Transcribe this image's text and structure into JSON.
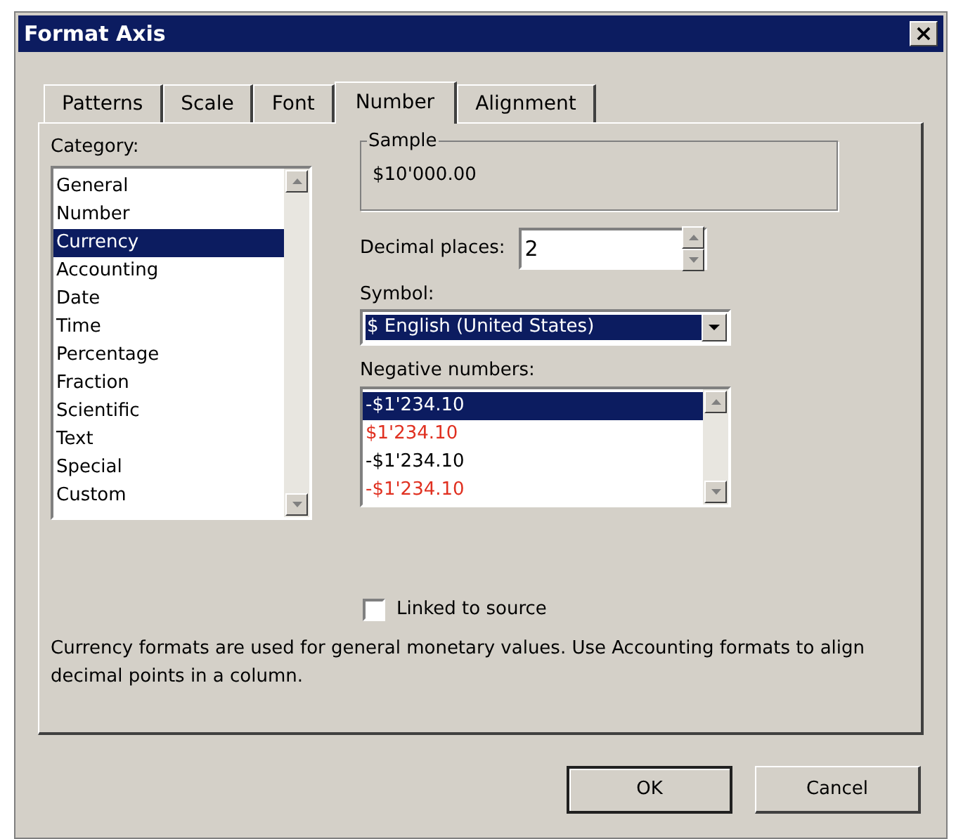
{
  "window": {
    "title": "Format Axis",
    "close_label": "×"
  },
  "tabs": [
    {
      "label": "Patterns",
      "selected": false
    },
    {
      "label": "Scale",
      "selected": false
    },
    {
      "label": "Font",
      "selected": false
    },
    {
      "label": "Number",
      "selected": true
    },
    {
      "label": "Alignment",
      "selected": false
    }
  ],
  "category": {
    "label": "Category:",
    "items": [
      {
        "label": "General",
        "selected": false
      },
      {
        "label": "Number",
        "selected": false
      },
      {
        "label": "Currency",
        "selected": true
      },
      {
        "label": "Accounting",
        "selected": false
      },
      {
        "label": "Date",
        "selected": false
      },
      {
        "label": "Time",
        "selected": false
      },
      {
        "label": "Percentage",
        "selected": false
      },
      {
        "label": "Fraction",
        "selected": false
      },
      {
        "label": "Scientific",
        "selected": false
      },
      {
        "label": "Text",
        "selected": false
      },
      {
        "label": "Special",
        "selected": false
      },
      {
        "label": "Custom",
        "selected": false
      }
    ]
  },
  "sample": {
    "label": "Sample",
    "value": "$10'000.00"
  },
  "decimal_places": {
    "label": "Decimal places:",
    "value": "2"
  },
  "symbol": {
    "label": "Symbol:",
    "value": "$ English (United States)"
  },
  "negative_numbers": {
    "label": "Negative numbers:",
    "items": [
      {
        "label": "-$1'234.10",
        "red": false,
        "selected": true
      },
      {
        "label": "$1'234.10",
        "red": true,
        "selected": false
      },
      {
        "label": "-$1'234.10",
        "red": false,
        "selected": false
      },
      {
        "label": "-$1'234.10",
        "red": true,
        "selected": false
      }
    ]
  },
  "linked_to_source": {
    "label": "Linked to source",
    "checked": false
  },
  "description": "Currency formats are used for general monetary values.  Use Accounting formats to align decimal points in a column.",
  "buttons": [
    {
      "label": "OK",
      "default": true
    },
    {
      "label": "Cancel",
      "default": false
    }
  ]
}
